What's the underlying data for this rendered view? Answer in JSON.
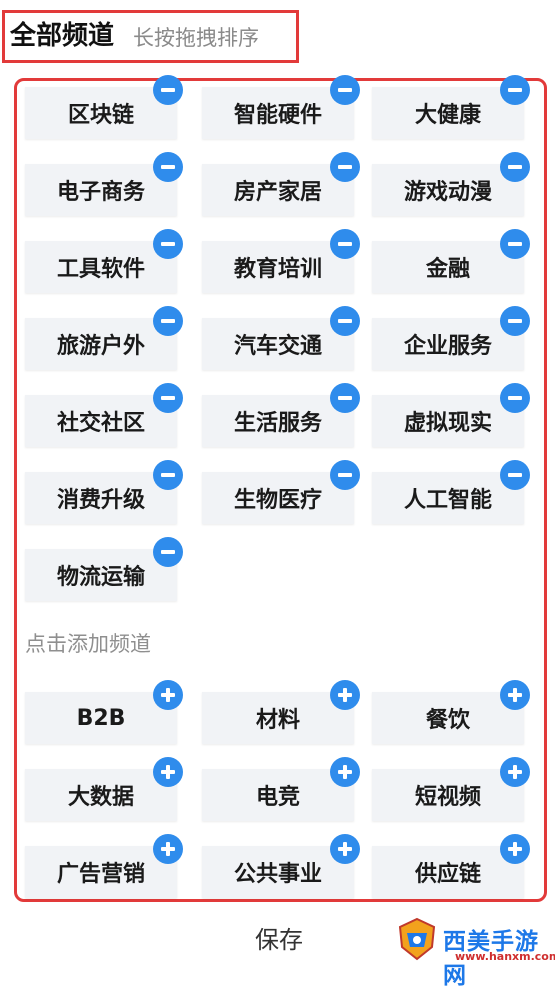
{
  "header": {
    "title": "全部频道",
    "hint": "长按拖拽排序"
  },
  "my_channels": [
    "区块链",
    "智能硬件",
    "大健康",
    "电子商务",
    "房产家居",
    "游戏动漫",
    "工具软件",
    "教育培训",
    "金融",
    "旅游户外",
    "汽车交通",
    "企业服务",
    "社交社区",
    "生活服务",
    "虚拟现实",
    "消费升级",
    "生物医疗",
    "人工智能",
    "物流运输"
  ],
  "add_section_label": "点击添加频道",
  "more_channels": [
    "B2B",
    "材料",
    "餐饮",
    "大数据",
    "电竞",
    "短视频",
    "广告营销",
    "公共事业",
    "供应链"
  ],
  "footer": {
    "save_label": "保存"
  },
  "watermark": {
    "name": "西美手游网",
    "url": "www.hanxm.com"
  },
  "colors": {
    "accent_blue": "#2f8cec",
    "highlight_red": "#e23a3a",
    "chip_bg": "#f1f3f6"
  },
  "icons": {
    "remove": "minus-circle-icon",
    "add": "plus-circle-icon"
  }
}
